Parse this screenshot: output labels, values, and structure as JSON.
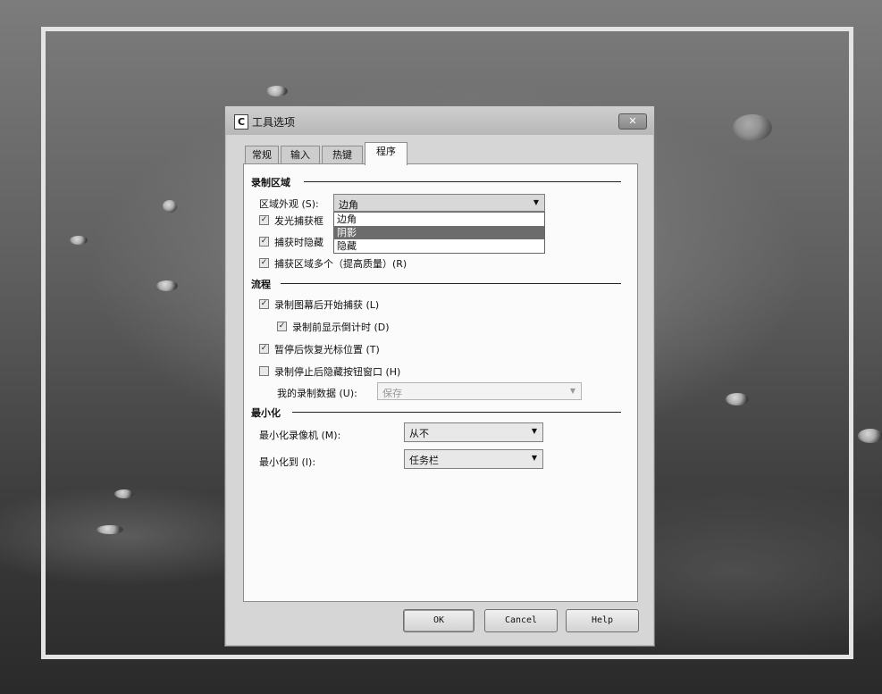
{
  "window": {
    "app_icon_letter": "C",
    "title": "工具选项",
    "close_label": "✕"
  },
  "tabs": [
    {
      "label": "常规",
      "active": false
    },
    {
      "label": "输入",
      "active": false
    },
    {
      "label": "热键",
      "active": false
    },
    {
      "label": "程序",
      "active": true
    }
  ],
  "sections": {
    "capture_region": {
      "heading": "录制区域",
      "appearance_label": "区域外观 (S):",
      "appearance_value": "边角",
      "appearance_options": [
        {
          "label": "边角",
          "selected": false
        },
        {
          "label": "阴影",
          "selected": true
        },
        {
          "label": "隐藏",
          "selected": false
        }
      ],
      "options": [
        {
          "label": "发光捕获框",
          "checked": true
        },
        {
          "label": "捕获时隐藏",
          "checked": true
        },
        {
          "label": "捕获区域多个（提高质量）(R)",
          "checked": true
        }
      ]
    },
    "workflow": {
      "heading": "流程",
      "options": [
        {
          "label": "录制图幕后开始捕获 (L)",
          "checked": true
        },
        {
          "label": "录制前显示倒计时 (D)",
          "checked": true
        },
        {
          "label": "暂停后恢复光标位置 (T)",
          "checked": true
        },
        {
          "label": "录制停止后隐藏按钮窗口 (H)",
          "checked": false
        }
      ],
      "save_to_label": "我的录制数据 (U):",
      "save_to_value": "保存"
    },
    "minimize": {
      "heading": "最小化",
      "minimize_recorder_label": "最小化录像机 (M):",
      "minimize_recorder_value": "从不",
      "minimize_to_label": "最小化到 (I):",
      "minimize_to_value": "任务栏"
    }
  },
  "buttons": {
    "ok": "OK",
    "cancel": "Cancel",
    "help": "Help"
  }
}
